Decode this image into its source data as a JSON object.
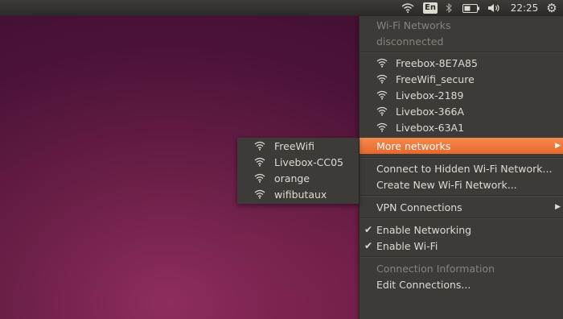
{
  "panel": {
    "keyboard_layout": "En",
    "clock": "22:25"
  },
  "menu": {
    "header_title": "Wi-Fi Networks",
    "header_status": "disconnected",
    "networks": [
      "Freebox-8E7A85",
      "FreeWifi_secure",
      "Livebox-2189",
      "Livebox-366A",
      "Livebox-63A1"
    ],
    "more_networks": "More networks",
    "connect_hidden": "Connect to Hidden Wi-Fi Network...",
    "create_new": "Create New Wi-Fi Network...",
    "vpn": "VPN Connections",
    "enable_networking": "Enable Networking",
    "enable_wifi": "Enable Wi-Fi",
    "connection_info": "Connection Information",
    "edit_connections": "Edit Connections..."
  },
  "submenu": {
    "networks": [
      "FreeWifi",
      "Livebox-CC05",
      "orange",
      "wifibutaux"
    ]
  },
  "colors": {
    "panel_bg": "#3c3b37",
    "menu_bg": "#3c3b37",
    "highlight": "#f07a3c",
    "text": "#dfdbd2",
    "disabled_text": "#86837b"
  },
  "icons": {
    "panel": [
      "wifi-icon",
      "keyboard-layout-icon",
      "bluetooth-icon",
      "battery-icon",
      "volume-icon",
      "gear-icon"
    ],
    "network_item": "wifi-signal-icon",
    "checkmark": "check-icon",
    "submenu_arrow": "chevron-right-icon"
  }
}
